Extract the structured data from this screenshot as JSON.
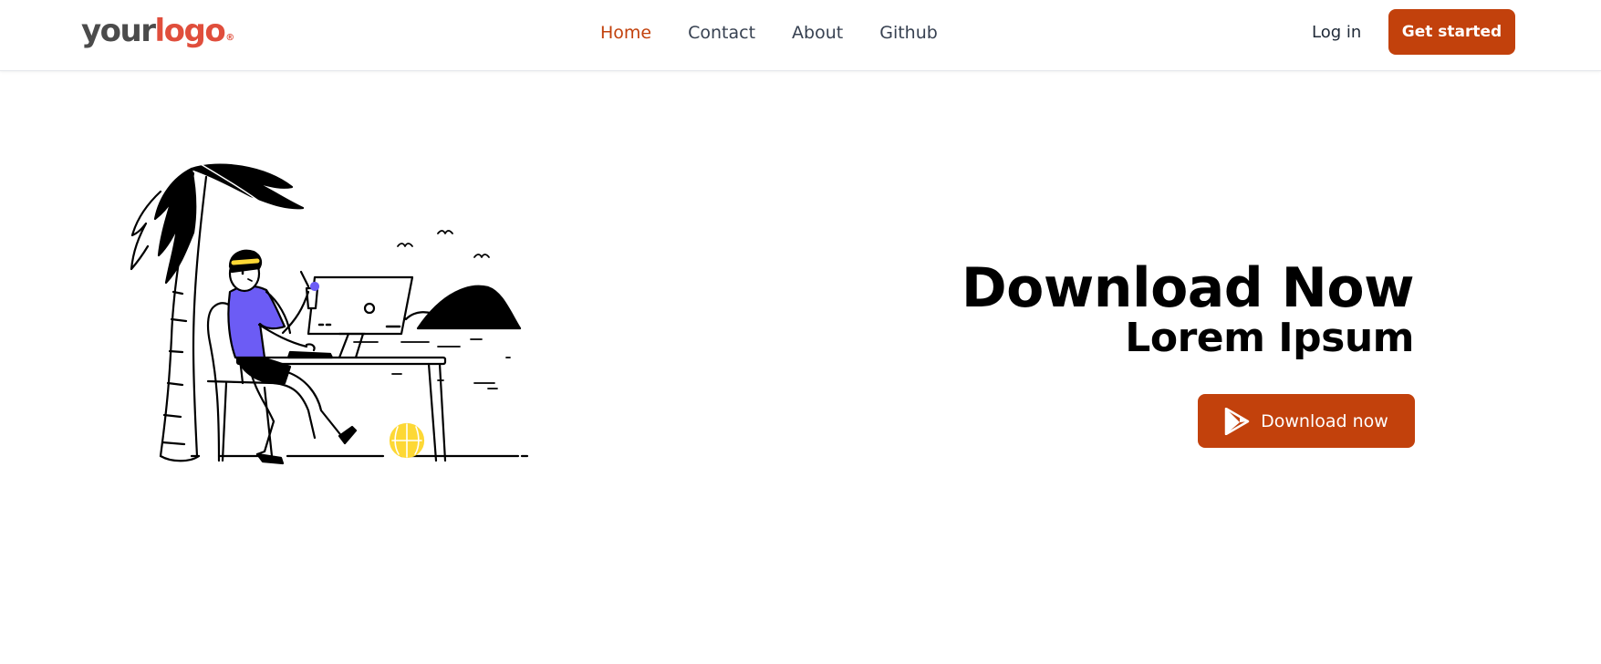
{
  "header": {
    "logo": {
      "word1": "your",
      "word2": "logo",
      "mark": "®"
    },
    "nav": [
      {
        "label": "Home",
        "active": true
      },
      {
        "label": "Contact",
        "active": false
      },
      {
        "label": "About",
        "active": false
      },
      {
        "label": "Github",
        "active": false
      }
    ],
    "login_label": "Log in",
    "cta_label": "Get started"
  },
  "hero": {
    "title": "Download Now",
    "subtitle": "Lorem Ipsum",
    "download_label": "Download now",
    "download_icon": "google-play-icon",
    "illustration": "person-working-on-laptop-at-beach-illustration"
  },
  "colors": {
    "accent": "#c2410c",
    "logo_red": "#e04e3c",
    "logo_gray": "#4b4b4b",
    "shirt": "#6c5cf5",
    "ball": "#fdd835",
    "text": "#000000"
  }
}
